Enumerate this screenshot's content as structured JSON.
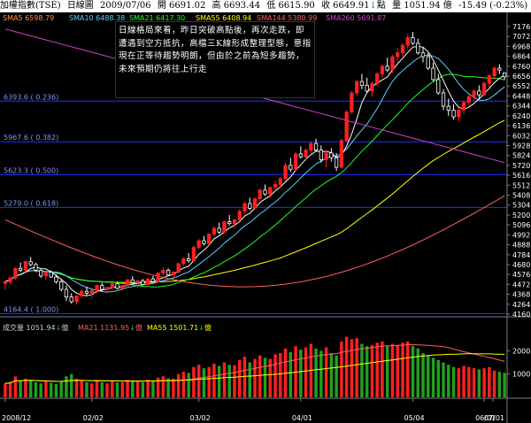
{
  "header": {
    "index_name": "加權指數(TSE)",
    "chart_kind": "日線圖",
    "date": "2009/07/06",
    "open": "開 6691.02",
    "high": "高 6693.44",
    "low": "低 6615.90",
    "close": "收 6649.91",
    "close_arrow": "↓",
    "points_label": "點",
    "volume": "量 1051.94 億",
    "change": "-15.49 (-0.23%)"
  },
  "ma_legend": {
    "ma5": "SMA5 6598.79",
    "ma10": "SMA10 6488.38",
    "ma21": "SMA21 6417.30",
    "ma55": "SMA55 6408.94",
    "ma144": "SMA144 5380.99",
    "ma260": "SMA260 5691.87"
  },
  "commentary": "日線格局來看，昨日突破高點後，再次走跌，即遭遇到空方抵抗，高檔三K線形成整理型態，意指現在正等待趨勢明朗，但由於之前為短多趨勢，未來預期仍將往上行走",
  "fib_levels": [
    {
      "label": "6393.6 ( 0.236)",
      "value": 6393.6
    },
    {
      "label": "5967.6 ( 0.382)",
      "value": 5967.6
    },
    {
      "label": "5623.3 ( 0.500)",
      "value": 5623.3
    },
    {
      "label": "5279.0 ( 0.618)",
      "value": 5279.0
    },
    {
      "label": "4164.4 ( 1.000)",
      "value": 4164.4
    }
  ],
  "volume_legend": {
    "vol": "成交量 1051.94",
    "vol_unit": "億",
    "ma21": "MA21 1131.95",
    "ma21_unit": "億",
    "ma55": "MA55 1501.71",
    "ma55_unit": "億"
  },
  "colors": {
    "up": "#ff2020",
    "down": "#ffffff",
    "ma5": "#ffffff",
    "ma10": "#5ad0ff",
    "ma21": "#20ff20",
    "ma55": "#ffff00",
    "ma144": "#ff6060",
    "ma260": "#d040d0",
    "fib": "#2030ff"
  },
  "chart_data": {
    "type": "candlestick",
    "price_ticks": [
      "7176",
      "7072",
      "6968",
      "6864",
      "6760",
      "6656",
      "6552",
      "6448",
      "6344",
      "6240",
      "6136",
      "6032",
      "5928",
      "5824",
      "5720",
      "5616",
      "5512",
      "5408",
      "5304",
      "5200",
      "5096",
      "4992",
      "4888",
      "4784",
      "4680",
      "4576",
      "4472",
      "4368",
      "4264",
      "4160"
    ],
    "price_ylim": [
      4160,
      7176
    ],
    "volume_ticks": [
      "2000",
      "1000"
    ],
    "volume_ylim": [
      0,
      2700
    ],
    "x_labels": [
      "2008/12",
      "02/02",
      "03/02",
      "04/01",
      "05/04",
      "06/01",
      "07/01"
    ],
    "candles": [
      [
        4480,
        4520,
        4420,
        4500
      ],
      [
        4500,
        4560,
        4470,
        4540
      ],
      [
        4540,
        4650,
        4520,
        4640
      ],
      [
        4640,
        4700,
        4600,
        4620
      ],
      [
        4620,
        4720,
        4590,
        4710
      ],
      [
        4710,
        4760,
        4660,
        4680
      ],
      [
        4680,
        4700,
        4600,
        4620
      ],
      [
        4620,
        4640,
        4540,
        4560
      ],
      [
        4560,
        4610,
        4520,
        4600
      ],
      [
        4600,
        4620,
        4540,
        4550
      ],
      [
        4550,
        4580,
        4480,
        4500
      ],
      [
        4500,
        4520,
        4400,
        4420
      ],
      [
        4420,
        4460,
        4300,
        4340
      ],
      [
        4340,
        4380,
        4270,
        4290
      ],
      [
        4290,
        4360,
        4260,
        4350
      ],
      [
        4350,
        4420,
        4330,
        4400
      ],
      [
        4400,
        4450,
        4360,
        4380
      ],
      [
        4380,
        4420,
        4330,
        4410
      ],
      [
        4410,
        4470,
        4380,
        4460
      ],
      [
        4460,
        4490,
        4400,
        4420
      ],
      [
        4420,
        4450,
        4380,
        4440
      ],
      [
        4440,
        4490,
        4420,
        4480
      ],
      [
        4480,
        4500,
        4420,
        4430
      ],
      [
        4430,
        4470,
        4410,
        4460
      ],
      [
        4460,
        4530,
        4440,
        4520
      ],
      [
        4520,
        4560,
        4480,
        4490
      ],
      [
        4490,
        4520,
        4440,
        4510
      ],
      [
        4510,
        4530,
        4460,
        4470
      ],
      [
        4470,
        4540,
        4460,
        4530
      ],
      [
        4530,
        4560,
        4490,
        4500
      ],
      [
        4500,
        4600,
        4490,
        4590
      ],
      [
        4590,
        4650,
        4560,
        4620
      ],
      [
        4620,
        4640,
        4560,
        4570
      ],
      [
        4570,
        4610,
        4540,
        4600
      ],
      [
        4600,
        4700,
        4590,
        4690
      ],
      [
        4690,
        4760,
        4670,
        4740
      ],
      [
        4740,
        4800,
        4700,
        4720
      ],
      [
        4720,
        4880,
        4710,
        4860
      ],
      [
        4860,
        4950,
        4840,
        4930
      ],
      [
        4930,
        4980,
        4880,
        4900
      ],
      [
        4900,
        5010,
        4880,
        5000
      ],
      [
        5000,
        5080,
        4970,
        5060
      ],
      [
        5060,
        5120,
        5000,
        5020
      ],
      [
        5020,
        5140,
        5010,
        5130
      ],
      [
        5130,
        5200,
        5090,
        5110
      ],
      [
        5110,
        5160,
        5060,
        5150
      ],
      [
        5150,
        5260,
        5130,
        5240
      ],
      [
        5240,
        5340,
        5210,
        5320
      ],
      [
        5320,
        5380,
        5250,
        5270
      ],
      [
        5270,
        5380,
        5260,
        5370
      ],
      [
        5370,
        5480,
        5350,
        5460
      ],
      [
        5460,
        5520,
        5400,
        5420
      ],
      [
        5420,
        5500,
        5380,
        5490
      ],
      [
        5490,
        5560,
        5450,
        5520
      ],
      [
        5520,
        5600,
        5480,
        5580
      ],
      [
        5580,
        5750,
        5560,
        5720
      ],
      [
        5720,
        5800,
        5650,
        5680
      ],
      [
        5680,
        5860,
        5660,
        5840
      ],
      [
        5840,
        5920,
        5790,
        5810
      ],
      [
        5810,
        5900,
        5770,
        5880
      ],
      [
        5880,
        5970,
        5850,
        5950
      ],
      [
        5950,
        6000,
        5860,
        5880
      ],
      [
        5880,
        5930,
        5750,
        5780
      ],
      [
        5780,
        5880,
        5700,
        5850
      ],
      [
        5850,
        5900,
        5760,
        5800
      ],
      [
        5800,
        5850,
        5660,
        5700
      ],
      [
        5700,
        6000,
        5690,
        5980
      ],
      [
        5980,
        6300,
        5970,
        6280
      ],
      [
        6280,
        6500,
        6260,
        6480
      ],
      [
        6480,
        6620,
        6450,
        6600
      ],
      [
        6600,
        6680,
        6520,
        6560
      ],
      [
        6560,
        6640,
        6480,
        6500
      ],
      [
        6500,
        6600,
        6440,
        6580
      ],
      [
        6580,
        6700,
        6550,
        6680
      ],
      [
        6680,
        6780,
        6640,
        6760
      ],
      [
        6760,
        6850,
        6700,
        6720
      ],
      [
        6720,
        6880,
        6690,
        6860
      ],
      [
        6860,
        6950,
        6800,
        6900
      ],
      [
        6900,
        7000,
        6860,
        6980
      ],
      [
        6980,
        7100,
        6940,
        7060
      ],
      [
        7060,
        7120,
        6980,
        7000
      ],
      [
        7000,
        7050,
        6880,
        6900
      ],
      [
        6900,
        6960,
        6800,
        6860
      ],
      [
        6860,
        6900,
        6720,
        6740
      ],
      [
        6740,
        6800,
        6600,
        6620
      ],
      [
        6620,
        6680,
        6460,
        6480
      ],
      [
        6480,
        6520,
        6300,
        6340
      ],
      [
        6340,
        6420,
        6240,
        6300
      ],
      [
        6300,
        6360,
        6200,
        6230
      ],
      [
        6230,
        6320,
        6180,
        6300
      ],
      [
        6300,
        6400,
        6260,
        6380
      ],
      [
        6380,
        6460,
        6340,
        6440
      ],
      [
        6440,
        6520,
        6400,
        6500
      ],
      [
        6500,
        6560,
        6420,
        6460
      ],
      [
        6460,
        6600,
        6440,
        6580
      ],
      [
        6580,
        6680,
        6540,
        6660
      ],
      [
        6660,
        6760,
        6620,
        6740
      ],
      [
        6740,
        6780,
        6680,
        6720
      ],
      [
        6691.02,
        6693.44,
        6615.9,
        6649.91
      ]
    ],
    "volumes": [
      600,
      650,
      900,
      700,
      800,
      750,
      650,
      600,
      700,
      620,
      580,
      700,
      900,
      1000,
      800,
      700,
      650,
      600,
      720,
      650,
      600,
      680,
      640,
      660,
      750,
      700,
      680,
      650,
      760,
      720,
      850,
      900,
      820,
      800,
      1000,
      1100,
      1050,
      1300,
      1400,
      1250,
      1300,
      1450,
      1350,
      1500,
      1400,
      1380,
      1600,
      1750,
      1500,
      1650,
      1800,
      1700,
      1650,
      1850,
      1900,
      2100,
      1950,
      2200,
      2050,
      2150,
      2300,
      2100,
      2000,
      2150,
      1900,
      1800,
      2400,
      2600,
      2500,
      2550,
      2300,
      2200,
      2250,
      2350,
      2400,
      2200,
      2300,
      2250,
      2350,
      2400,
      2200,
      2100,
      1900,
      1800,
      1700,
      1600,
      1500,
      1400,
      1300,
      1250,
      1350,
      1300,
      1250,
      1200,
      1250,
      1300,
      1150,
      1100,
      1051.94
    ]
  }
}
